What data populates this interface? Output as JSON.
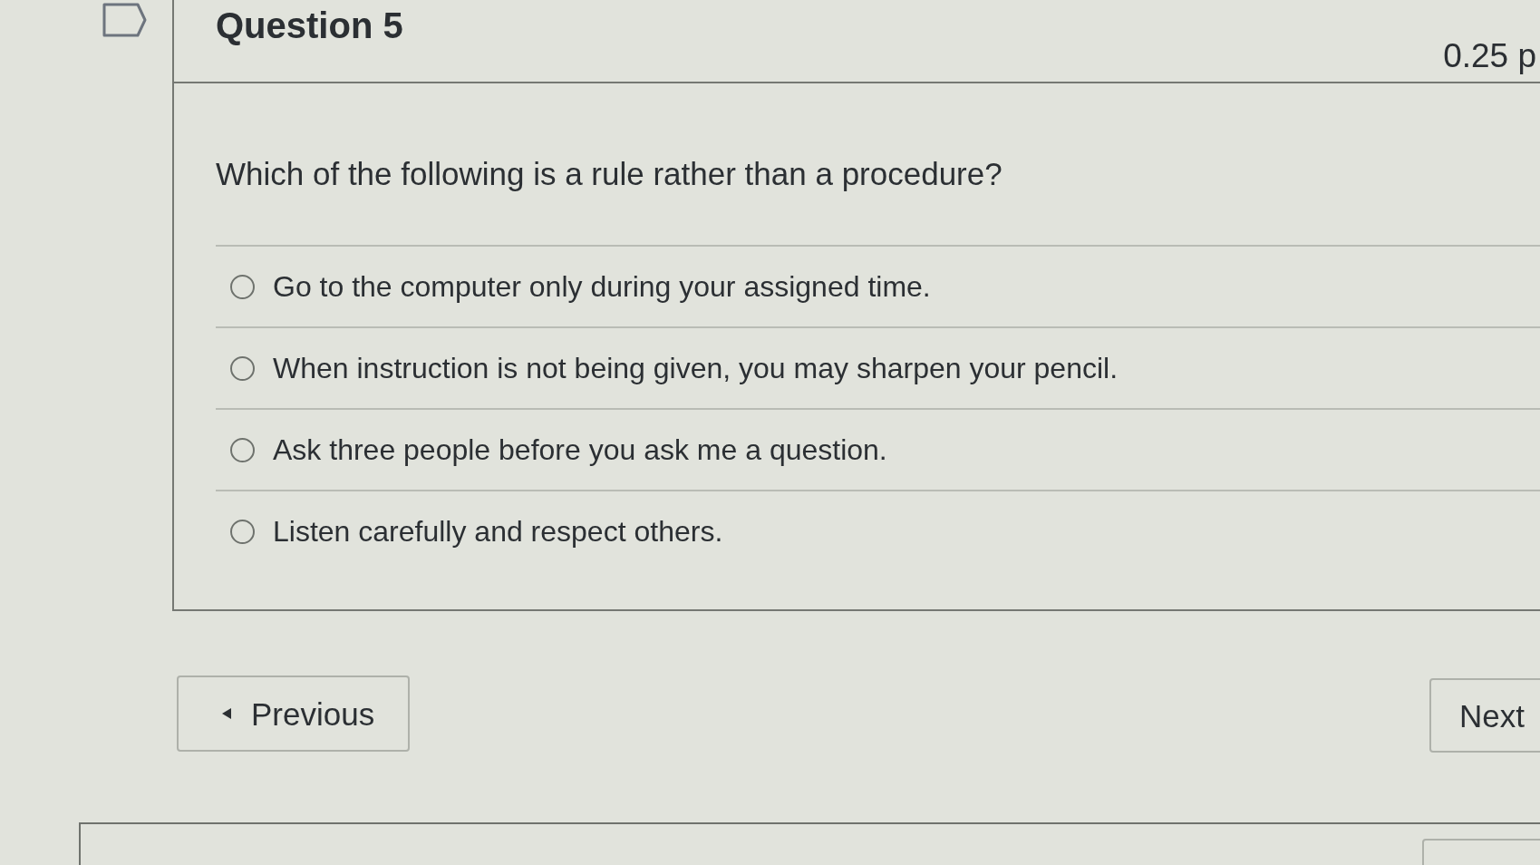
{
  "question": {
    "title": "Question 5",
    "points": "0.25 p",
    "text": "Which of the following is a rule rather than a procedure?",
    "answers": [
      {
        "label": "Go to the computer only during your assigned time.",
        "selected": false
      },
      {
        "label": "When instruction is not being given, you may sharpen your pencil.",
        "selected": false
      },
      {
        "label": "Ask three people before you ask me a question.",
        "selected": false
      },
      {
        "label": "Listen carefully and respect others.",
        "selected": false
      }
    ]
  },
  "navigation": {
    "previous": "Previous",
    "next": "Next"
  }
}
